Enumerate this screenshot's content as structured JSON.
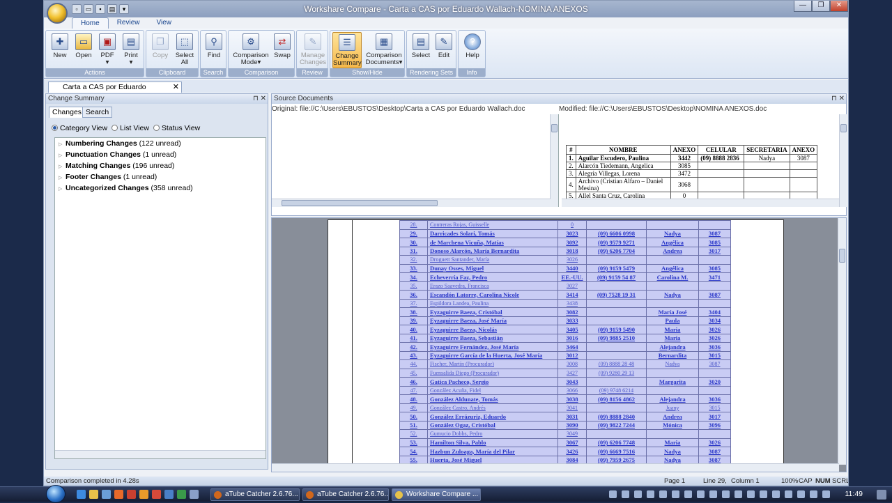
{
  "window": {
    "title": "Workshare Compare - Carta a CAS por Eduardo Wallach-NOMINA ANEXOS",
    "controls": [
      "—",
      "❐",
      "✕"
    ]
  },
  "ribbon": {
    "tabs": [
      "Home",
      "Review",
      "View"
    ],
    "groups": [
      {
        "label": "Actions",
        "buttons": [
          {
            "label": "New",
            "icon": "new-document-icon"
          },
          {
            "label": "Open",
            "icon": "open-folder-icon"
          },
          {
            "label": "PDF",
            "icon": "pdf-icon"
          },
          {
            "label": "Print",
            "icon": "printer-icon"
          }
        ]
      },
      {
        "label": "Clipboard",
        "buttons": [
          {
            "label": "Copy",
            "icon": "copy-icon"
          },
          {
            "label": "Select All",
            "icon": "select-all-icon"
          }
        ]
      },
      {
        "label": "Search",
        "buttons": [
          {
            "label": "Find",
            "icon": "find-icon"
          }
        ]
      },
      {
        "label": "Comparison",
        "buttons": [
          {
            "label": "Comparison Mode",
            "icon": "comparison-mode-icon"
          },
          {
            "label": "Swap",
            "icon": "swap-icon"
          }
        ]
      },
      {
        "label": "Review",
        "buttons": [
          {
            "label": "Manage Changes",
            "icon": "manage-changes-icon"
          }
        ]
      },
      {
        "label": "Show/Hide",
        "buttons": [
          {
            "label": "Change Summary",
            "icon": "change-summary-icon"
          },
          {
            "label": "Comparison Documents",
            "icon": "comparison-documents-icon"
          }
        ]
      },
      {
        "label": "Rendering Sets",
        "buttons": [
          {
            "label": "Select",
            "icon": "select-set-icon"
          },
          {
            "label": "Edit",
            "icon": "edit-set-icon"
          }
        ]
      },
      {
        "label": "Info",
        "buttons": [
          {
            "label": "Help",
            "icon": "help-icon"
          }
        ]
      }
    ]
  },
  "doc_tab": {
    "label": "Carta a CAS por Eduardo Wallach-..."
  },
  "change_summary": {
    "title": "Change Summary",
    "tabs": [
      "Changes",
      "Search"
    ],
    "views": [
      "Category View",
      "List View",
      "Status View"
    ],
    "categories": [
      {
        "name": "Numbering Changes",
        "count": "(122 unread)"
      },
      {
        "name": "Punctuation Changes",
        "count": "(1 unread)"
      },
      {
        "name": "Matching Changes",
        "count": "(196 unread)"
      },
      {
        "name": "Footer Changes",
        "count": "(1 unread)"
      },
      {
        "name": "Uncategorized Changes",
        "count": "(358 unread)"
      }
    ]
  },
  "source_documents": {
    "title": "Source Documents",
    "original": "Original: file://C:\\Users\\EBUSTOS\\Desktop\\Carta a CAS por Eduardo Wallach.doc",
    "modified": "Modified: file://C:\\Users\\EBUSTOS\\Desktop\\NOMINA ANEXOS.doc",
    "table_headers": [
      "#",
      "NOMBRE",
      "ANEXO",
      "CELULAR",
      "SECRETARIA",
      "ANEXO"
    ],
    "table_rows": [
      [
        "1.",
        "Aguilar Escudero, Paulina",
        "3442",
        "(09) 8888 2836",
        "Nadya",
        "3087"
      ],
      [
        "2.",
        "Alarcón Tiedemann, Angelica",
        "3085",
        "",
        "",
        ""
      ],
      [
        "3.",
        "Alegría Villegas, Lorena",
        "3472",
        "",
        "",
        ""
      ],
      [
        "4.",
        "Archivo (Cristian Alfaro – Daniel Mesina)",
        "3068",
        "",
        "",
        ""
      ],
      [
        "5.",
        "Allel Santa Cruz, Carolina",
        "0",
        "",
        "",
        ""
      ]
    ]
  },
  "comparison": {
    "rows": [
      {
        "n": "28.",
        "name": "Contreras Rojas, Guisselle",
        "anexo": "0",
        "cel": "",
        "sec": "",
        "ax": "",
        "bold": false
      },
      {
        "n": "29.",
        "name": "Darricades Solari, Tomás",
        "anexo": "3023",
        "cel": "(09) 6606 0998",
        "sec": "Nadya",
        "ax": "3087",
        "bold": true
      },
      {
        "n": "30.",
        "name": "de Marchena Vicuña, Matías",
        "anexo": "3092",
        "cel": "(09) 9579 9271",
        "sec": "Angélica",
        "ax": "3085",
        "bold": true
      },
      {
        "n": "31.",
        "name": "Donoso Alarcón, María Bernardita",
        "anexo": "3018",
        "cel": "(09) 6206 7704",
        "sec": "Andrea",
        "ax": "3017",
        "bold": true
      },
      {
        "n": "32.",
        "name": "Droguett Santander, María",
        "anexo": "3026",
        "cel": "",
        "sec": "",
        "ax": "",
        "bold": false
      },
      {
        "n": "33.",
        "name": "Dunay Osses, Miguel",
        "anexo": "3440",
        "cel": "(09) 9159 5479",
        "sec": "Angélica",
        "ax": "3085",
        "bold": true
      },
      {
        "n": "34.",
        "name": "Echeverría Faz, Pedro",
        "anexo": "EE.-UU.",
        "cel": "(09) 9159 54 87",
        "sec": "Carolina M.",
        "ax": "3471",
        "bold": true
      },
      {
        "n": "35.",
        "name": "Erazo Saavedra, Francisca",
        "anexo": "3027",
        "cel": "",
        "sec": "",
        "ax": "",
        "bold": false
      },
      {
        "n": "36.",
        "name": "Escandón Latorre, Carolina Nicole",
        "anexo": "3414",
        "cel": "(09) 7528 19 31",
        "sec": "Nadya",
        "ax": "3087",
        "bold": true
      },
      {
        "n": "37.",
        "name": "Espildora Landea, Paulina",
        "anexo": "3438",
        "cel": "",
        "sec": "",
        "ax": "",
        "bold": false
      },
      {
        "n": "38.",
        "name": "Eyzaguirre Baeza, Cristóbal",
        "anexo": "3082",
        "cel": "",
        "sec": "María José",
        "ax": "3404",
        "bold": true
      },
      {
        "n": "39.",
        "name": "Eyzaguirre Baeza, José María",
        "anexo": "3033",
        "cel": "",
        "sec": "Paula",
        "ax": "3034",
        "bold": true
      },
      {
        "n": "40.",
        "name": "Eyzaguirre Baeza, Nicolás",
        "anexo": "3405",
        "cel": "(09) 9159 5490",
        "sec": "Maria",
        "ax": "3026",
        "bold": true
      },
      {
        "n": "41.",
        "name": "Eyzaguirre Baeza, Sebastián",
        "anexo": "3016",
        "cel": "(09) 9885 2510",
        "sec": "Maria",
        "ax": "3026",
        "bold": true
      },
      {
        "n": "42.",
        "name": "Eyzaguirre Fernández, José María",
        "anexo": "3464",
        "cel": "",
        "sec": "Alejandra",
        "ax": "3036",
        "bold": true
      },
      {
        "n": "43.",
        "name": "Eyzaguirre García de la Huerta, José María",
        "anexo": "3012",
        "cel": "",
        "sec": "Bernardita",
        "ax": "3015",
        "bold": true
      },
      {
        "n": "44.",
        "name": "Fischer, Martín (Procurador)",
        "anexo": "3008",
        "cel": "(09) 8888 28 48",
        "sec": "Nadya",
        "ax": "3087",
        "bold": false
      },
      {
        "n": "45.",
        "name": "Fuensalida Diego (Procurador)",
        "anexo": "3427",
        "cel": "(09) 9280 29 13",
        "sec": "",
        "ax": "",
        "bold": false
      },
      {
        "n": "46.",
        "name": "Gatica Pacheco, Sergio",
        "anexo": "3043",
        "cel": "",
        "sec": "Margarita",
        "ax": "3020",
        "bold": true
      },
      {
        "n": "47.",
        "name": "González Acuña, Fidel",
        "anexo": "3066",
        "cel": "(09) 9748 6214",
        "sec": "",
        "ax": "",
        "bold": false
      },
      {
        "n": "48.",
        "name": "González Aldunate, Tomás",
        "anexo": "3038",
        "cel": "(09) 8156 4862",
        "sec": "Alejandra",
        "ax": "3036",
        "bold": true
      },
      {
        "n": "49.",
        "name": "González Castro, Andrés",
        "anexo": "3041",
        "cel": "",
        "sec": "Juany",
        "ax": "3015",
        "bold": false
      },
      {
        "n": "50.",
        "name": "González Errázuriz, Eduardo",
        "anexo": "3031",
        "cel": "(09) 8888 2840",
        "sec": "Andrea",
        "ax": "3017",
        "bold": true
      },
      {
        "n": "51.",
        "name": "González Ogaz, Cristóbal",
        "anexo": "3090",
        "cel": "(09) 9822 7244",
        "sec": "Mónica",
        "ax": "3096",
        "bold": true
      },
      {
        "n": "52.",
        "name": "Gumucio Dobbs, Pedro",
        "anexo": "3049",
        "cel": "",
        "sec": "",
        "ax": "",
        "bold": false
      },
      {
        "n": "53.",
        "name": "Hamilton Silva, Pablo",
        "anexo": "3067",
        "cel": "(09) 6206 7748",
        "sec": "Maria",
        "ax": "3026",
        "bold": true
      },
      {
        "n": "54.",
        "name": "Hazbun Zuloaga, María del Pilar",
        "anexo": "3426",
        "cel": "(09) 6669 7516",
        "sec": "Nadya",
        "ax": "3087",
        "bold": true
      },
      {
        "n": "55.",
        "name": "Huerta, José Miguel",
        "anexo": "3084",
        "cel": "(09) 7959 2675",
        "sec": "Nadya",
        "ax": "3087",
        "bold": true
      }
    ]
  },
  "statusbar": {
    "message": "Comparison completed in 4.28s",
    "page": "Page 1",
    "line": "Line 29,",
    "column": "Column 1",
    "zoom": "100%",
    "cap": "CAP",
    "num": "NUM",
    "scrl": "SCRL"
  },
  "taskbar": {
    "buttons": [
      "aTube Catcher 2.6.76...",
      "aTube Catcher 2.6.76...",
      "Workshare Compare ..."
    ],
    "clock": "11:49"
  }
}
